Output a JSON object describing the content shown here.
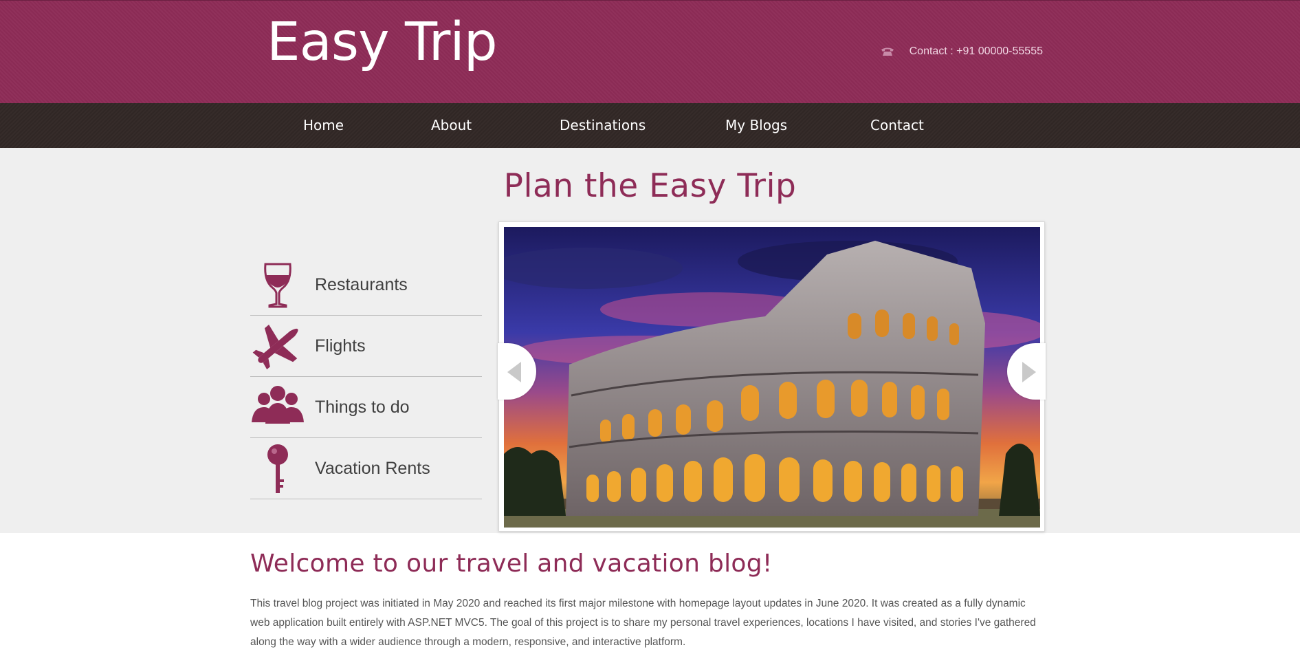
{
  "header": {
    "logo": "Easy Trip",
    "contact": "Contact : +91 00000-55555",
    "contact_icon": "phone-icon"
  },
  "nav": {
    "items": [
      {
        "label": "Home"
      },
      {
        "label": "About"
      },
      {
        "label": "Destinations"
      },
      {
        "label": "My Blogs"
      },
      {
        "label": "Contact"
      }
    ]
  },
  "hero": {
    "title": "Plan the Easy Trip",
    "services": [
      {
        "label": "Restaurants",
        "icon": "wine-glass-icon"
      },
      {
        "label": "Flights",
        "icon": "airplane-icon"
      },
      {
        "label": "Things to do",
        "icon": "people-icon"
      },
      {
        "label": "Vacation Rents",
        "icon": "key-icon"
      }
    ],
    "slider": {
      "image": "colosseum-image",
      "prev_icon": "arrow-left-icon",
      "next_icon": "arrow-right-icon"
    }
  },
  "welcome": {
    "title": "Welcome to our travel and vacation blog!",
    "text": "This travel blog project was initiated in May 2020 and reached its first major milestone with homepage layout updates in June 2020. It was created as a fully dynamic web application built entirely with ASP.NET MVC5. The goal of this project is to share my personal travel experiences, locations I have visited, and stories I've gathered along the way with a wider audience through a modern, responsive, and interactive platform."
  },
  "colors": {
    "brand": "#8e2c57",
    "nav_bg": "#322826",
    "hero_bg": "#efefef",
    "text": "#555555"
  }
}
